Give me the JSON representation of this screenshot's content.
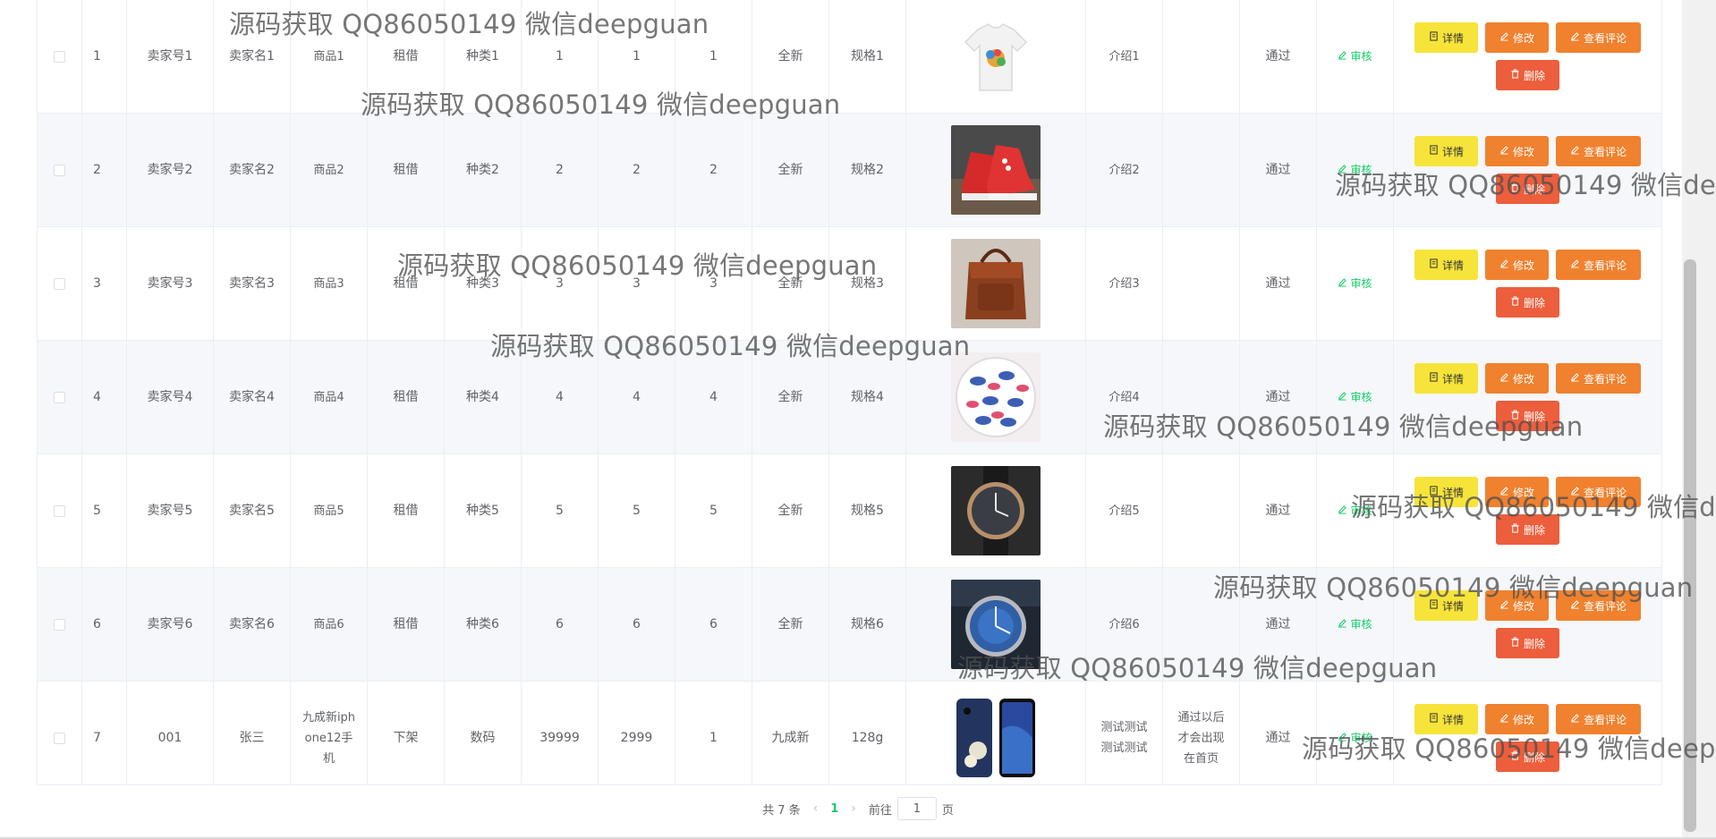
{
  "rows": [
    {
      "index": "1",
      "seller_no": "卖家号1",
      "seller_name": "卖家名1",
      "product": "商品1",
      "mode": "租借",
      "category": "种类1",
      "v1": "1",
      "v2": "1",
      "v3": "1",
      "condition": "全新",
      "spec": "规格1",
      "image": "tshirt",
      "intro": "介绍1",
      "note": "",
      "status": "通过",
      "audit": "审核"
    },
    {
      "index": "2",
      "seller_no": "卖家号2",
      "seller_name": "卖家名2",
      "product": "商品2",
      "mode": "租借",
      "category": "种类2",
      "v1": "2",
      "v2": "2",
      "v3": "2",
      "condition": "全新",
      "spec": "规格2",
      "image": "shoes",
      "intro": "介绍2",
      "note": "",
      "status": "通过",
      "audit": "审核"
    },
    {
      "index": "3",
      "seller_no": "卖家号3",
      "seller_name": "卖家名3",
      "product": "商品3",
      "mode": "租借",
      "category": "种类3",
      "v1": "3",
      "v2": "3",
      "v3": "3",
      "condition": "全新",
      "spec": "规格3",
      "image": "bag",
      "intro": "介绍3",
      "note": "",
      "status": "通过",
      "audit": "审核"
    },
    {
      "index": "4",
      "seller_no": "卖家号4",
      "seller_name": "卖家名4",
      "product": "商品4",
      "mode": "租借",
      "category": "种类4",
      "v1": "4",
      "v2": "4",
      "v3": "4",
      "condition": "全新",
      "spec": "规格4",
      "image": "candy",
      "intro": "介绍4",
      "note": "",
      "status": "通过",
      "audit": "审核"
    },
    {
      "index": "5",
      "seller_no": "卖家号5",
      "seller_name": "卖家名5",
      "product": "商品5",
      "mode": "租借",
      "category": "种类5",
      "v1": "5",
      "v2": "5",
      "v3": "5",
      "condition": "全新",
      "spec": "规格5",
      "image": "watch",
      "intro": "介绍5",
      "note": "",
      "status": "通过",
      "audit": "审核"
    },
    {
      "index": "6",
      "seller_no": "卖家号6",
      "seller_name": "卖家名6",
      "product": "商品6",
      "mode": "租借",
      "category": "种类6",
      "v1": "6",
      "v2": "6",
      "v3": "6",
      "condition": "全新",
      "spec": "规格6",
      "image": "watch-blue",
      "intro": "介绍6",
      "note": "",
      "status": "通过",
      "audit": "审核"
    },
    {
      "index": "7",
      "seller_no": "001",
      "seller_name": "张三",
      "product": "九成新iphone12手机",
      "mode": "下架",
      "category": "数码",
      "v1": "39999",
      "v2": "2999",
      "v3": "1",
      "condition": "九成新",
      "spec": "128g",
      "image": "phone",
      "intro": "测试测试测试测试",
      "note": "通过以后才会出现在首页",
      "status": "通过",
      "audit": "审核"
    }
  ],
  "actions": {
    "detail": "详情",
    "edit": "修改",
    "comments": "查看评论",
    "delete": "删除"
  },
  "pagination": {
    "total": "共 7 条",
    "current_page": "1",
    "goto_prefix": "前往",
    "goto_value": "1",
    "goto_suffix": "页"
  },
  "watermark": "源码获取 QQ86050149 微信deepguan",
  "colors": {
    "detail_button": "#f7e43a",
    "edit_button": "#f0812e",
    "delete_button": "#ec5e3c",
    "accent_green": "#13ce66",
    "stripe": "#f5f7fa"
  }
}
